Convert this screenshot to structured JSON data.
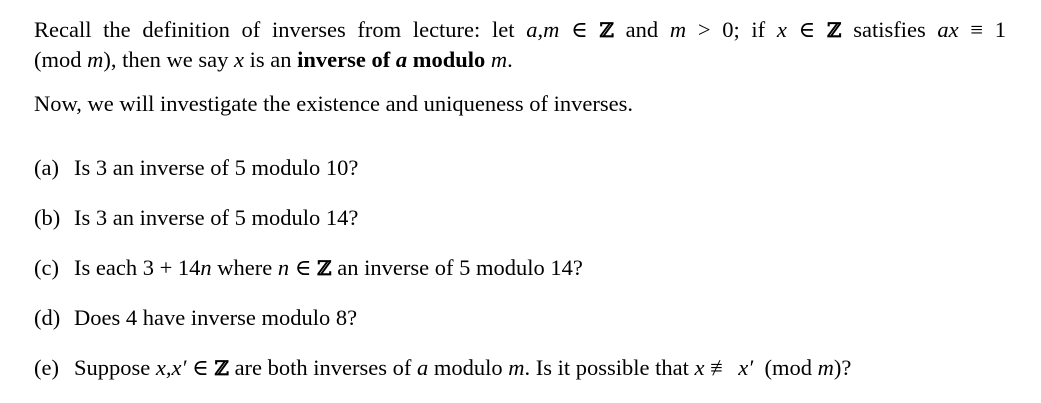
{
  "intro": {
    "line1": {
      "t1": "Recall the definition of inverses from lecture: let ",
      "a": "a",
      "comma": ",",
      "m": "m",
      "in1": " ∈ ",
      "Z1": "ℤ",
      "and": " and ",
      "m2": "m",
      "gt0": " > 0; if ",
      "x": "x",
      "in2": " ∈ ",
      "Z2": "ℤ",
      "satisfies": " satisfies ",
      "ax": "ax",
      "equiv1": " ≡ 1"
    },
    "line2": {
      "mod": "(mod ",
      "m": "m",
      "close": "), then we say ",
      "x": "x",
      "is_an": " is an ",
      "bold_inverse": "inverse of ",
      "a": "a",
      "bold_modulo": " modulo ",
      "m2": "m",
      "period": "."
    },
    "line3": "Now, we will investigate the existence and uniqueness of inverses."
  },
  "questions": {
    "a": {
      "label": "(a)",
      "text": "Is 3 an inverse of 5 modulo 10?"
    },
    "b": {
      "label": "(b)",
      "text": "Is 3 an inverse of 5 modulo 14?"
    },
    "c": {
      "label": "(c)",
      "t1": "Is each 3 + 14",
      "n": "n",
      "t2": " where ",
      "n2": "n",
      "t3": " ∈ ",
      "Z": "ℤ",
      "t4": " an inverse of 5 modulo 14?"
    },
    "d": {
      "label": "(d)",
      "text": "Does 4 have inverse modulo 8?"
    },
    "e": {
      "label": "(e)",
      "t1": "Suppose ",
      "xxp": "x,x′",
      "t2": " ∈ ",
      "Z": "ℤ",
      "t3": " are both inverses of ",
      "a": "a",
      "t4": " modulo ",
      "m": "m",
      "t5": ". Is it possible that ",
      "x": "x",
      "nequiv": " ≢ ",
      "xp": "x′",
      "t6": "  (mod ",
      "m2": "m",
      "t7": ")?"
    }
  }
}
